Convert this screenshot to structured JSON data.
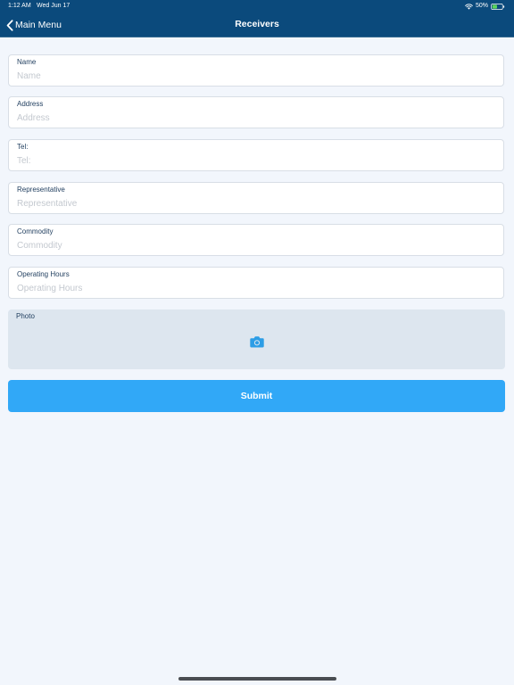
{
  "status_bar": {
    "time": "1:12 AM",
    "date": "Wed Jun 17",
    "battery_percent": "50%",
    "battery_level": 0.5,
    "wifi_icon": "wifi-icon",
    "battery_icon": "battery-icon"
  },
  "nav": {
    "back_label": "Main Menu",
    "back_icon": "chevron-left-icon",
    "title": "Receivers"
  },
  "form": {
    "fields": [
      {
        "label": "Name",
        "placeholder": "Name",
        "value": ""
      },
      {
        "label": "Address",
        "placeholder": "Address",
        "value": ""
      },
      {
        "label": "Tel:",
        "placeholder": "Tel:",
        "value": ""
      },
      {
        "label": "Representative",
        "placeholder": "Representative",
        "value": ""
      },
      {
        "label": "Commodity",
        "placeholder": "Commodity",
        "value": ""
      },
      {
        "label": "Operating Hours",
        "placeholder": "Operating Hours",
        "value": ""
      }
    ],
    "photo": {
      "label": "Photo",
      "icon": "camera-icon"
    },
    "submit_label": "Submit"
  },
  "colors": {
    "header_bg": "#0b4a7c",
    "page_bg": "#f2f6fc",
    "accent": "#31a8f7",
    "photo_bg": "#dde6ef",
    "label_text": "#1f3d5e",
    "placeholder_text": "#c3c8cf"
  }
}
